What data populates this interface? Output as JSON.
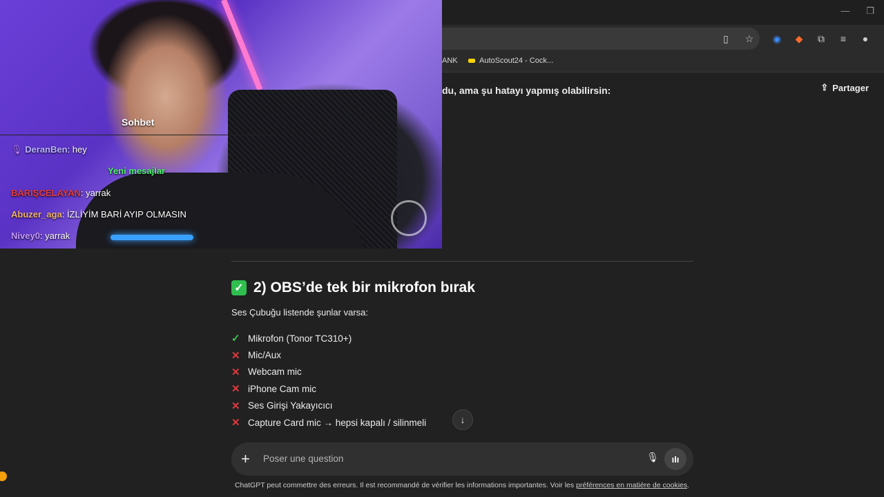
{
  "browser": {
    "window_controls": {
      "minimize": "—",
      "restore": "❐"
    },
    "bookmarks": [
      {
        "label": "ANK"
      },
      {
        "label": "AutoScout24 - Cock..."
      }
    ]
  },
  "chat": {
    "share_label": "Partager",
    "intro_text": "du, ama şu hatayı yapmış olabilirsin:",
    "section_heading": "2) OBS’de tek bir mikrofon bırak",
    "section_sub": "Ses Çubuğu listende şunlar varsa:",
    "items": [
      {
        "status": "ok",
        "label": "Mikrofon (Tonor TC310+)"
      },
      {
        "status": "no",
        "label": "Mic/Aux"
      },
      {
        "status": "no",
        "label": "Webcam mic"
      },
      {
        "status": "no",
        "label": "iPhone Cam mic"
      },
      {
        "status": "no",
        "label": "Ses Girişi Yakayıcıcı"
      },
      {
        "status": "no",
        "label": "Capture Card mic → hepsi kapalı / silinmeli"
      }
    ],
    "composer_placeholder": "Poser une question",
    "footer_text": "ChatGPT peut commettre des erreurs. Il est recommandé de vérifier les informations importantes. Voir les ",
    "footer_link": "préférences en matière de cookies",
    "footer_end": "."
  },
  "stream_overlay": {
    "chat_title": "Sohbet",
    "messages": [
      {
        "user": "DeranBen",
        "text": ": hey",
        "color": "#b9b4ff"
      },
      {
        "user": "BARIŞCELAYAN",
        "text": ": yarrak",
        "color": "#e23b3b"
      },
      {
        "user": "Abuzer_aga",
        "text": ": İZLİYİM BARİ AYIP OLMASIN",
        "color": "#f0b36a"
      },
      {
        "user": "Nivey0",
        "text": ": yarrak",
        "color": "#c59bff"
      }
    ],
    "new_messages_label": "Yeni mesajlar"
  },
  "colors": {
    "ok": "#39c553",
    "no": "#e0393e",
    "new_messages": "#4cf06a"
  }
}
